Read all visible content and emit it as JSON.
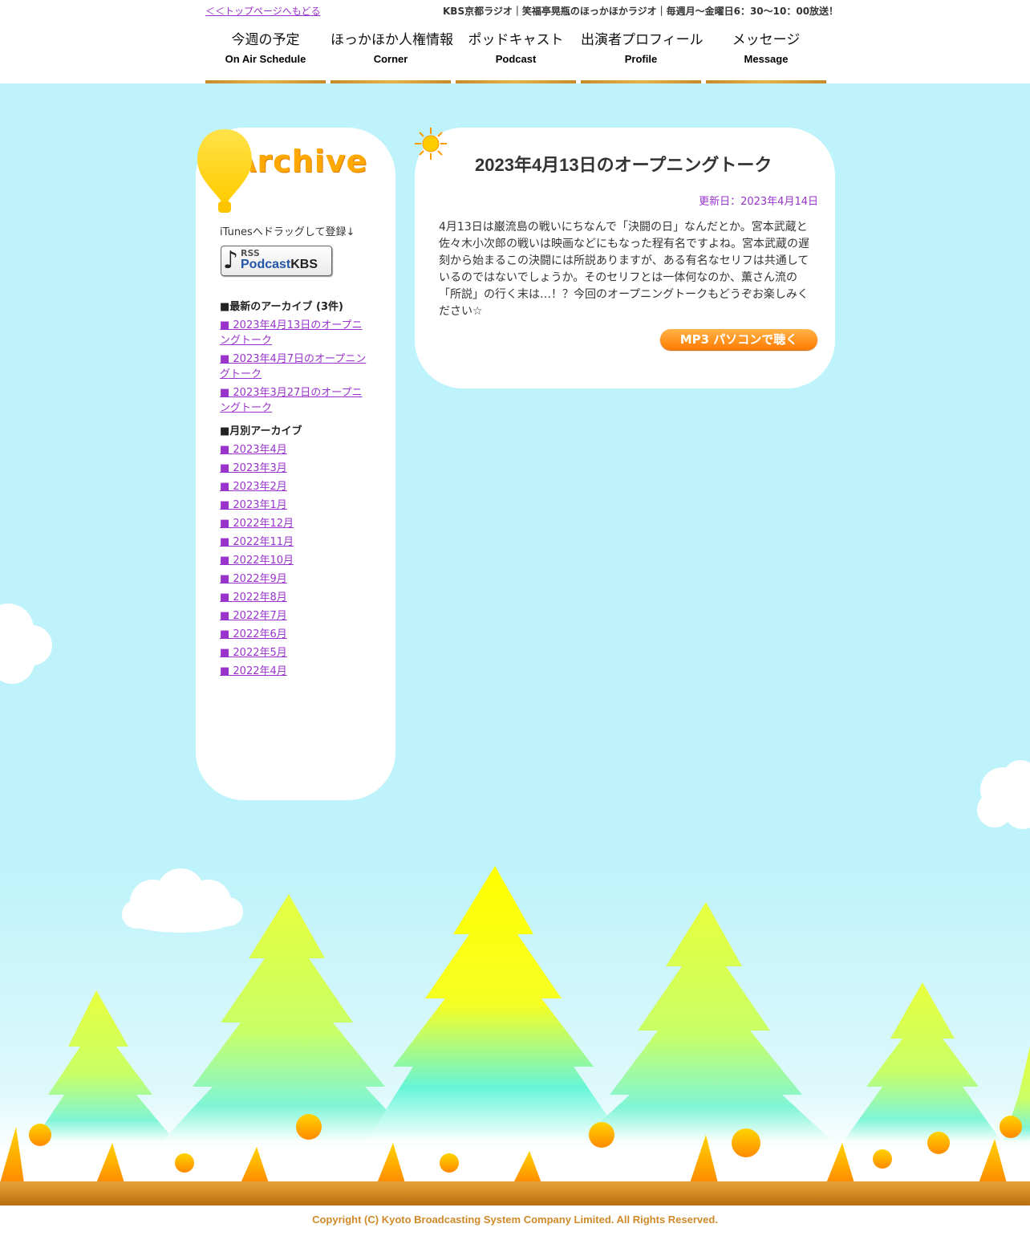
{
  "header": {
    "back_link": "＜＜トップページへもどる",
    "tagline": "KBS京都ラジオ｜笑福亭晃瓶のほっかほかラジオ｜毎週月～金曜日6：30～10：00放送！"
  },
  "nav": [
    {
      "jp": "今週の予定",
      "en": "On Air Schedule"
    },
    {
      "jp": "ほっかほか人権情報",
      "en": "Corner"
    },
    {
      "jp": "ポッドキャスト",
      "en": "Podcast"
    },
    {
      "jp": "出演者プロフィール",
      "en": "Profile"
    },
    {
      "jp": "メッセージ",
      "en": "Message"
    }
  ],
  "sidebar": {
    "title": "Archive",
    "itunes_label": "iTunesへドラッグして登録↓",
    "rss_badge": {
      "rss": "RSS",
      "podcast": "Podcast",
      "kbs": "KBS"
    },
    "latest_heading": "■最新のアーカイブ (3件)",
    "latest": [
      "■ 2023年4月13日のオープニングトーク",
      "■ 2023年4月7日のオープニングトーク",
      "■ 2023年3月27日のオープニングトーク"
    ],
    "monthly_heading": "■月別アーカイブ",
    "monthly": [
      "■ 2023年4月",
      "■ 2023年3月",
      "■ 2023年2月",
      "■ 2023年1月",
      "■ 2022年12月",
      "■ 2022年11月",
      "■ 2022年10月",
      "■ 2022年9月",
      "■ 2022年8月",
      "■ 2022年7月",
      "■ 2022年6月",
      "■ 2022年5月",
      "■ 2022年4月"
    ]
  },
  "article": {
    "title": "2023年4月13日のオープニングトーク",
    "updated": "更新日：2023年4月14日",
    "body": "4月13日は巌流島の戦いにちなんで「決闘の日」なんだとか。宮本武蔵と佐々木小次郎の戦いは映画などにもなった程有名ですよね。宮本武蔵の遅刻から始まるこの決闘には所説ありますが、ある有名なセリフは共通しているのではないでしょうか。そのセリフとは一体何なのか、薫さん流の「所説」の行く末は…！？今回のオープニングトークもどうぞお楽しみください☆",
    "mp3_button": "MP3 パソコンで聴く"
  },
  "footer": {
    "copyright": "Copyright (C) Kyoto Broadcasting System Company Limited. All Rights Reserved."
  },
  "colors": {
    "link": "#9933cc",
    "sky": "#bff3fb",
    "accent_orange": "#ff8c00"
  }
}
